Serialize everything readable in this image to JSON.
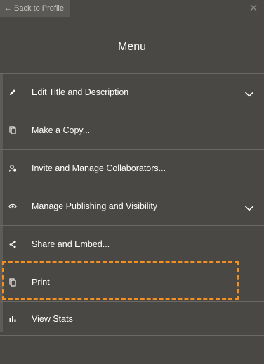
{
  "header": {
    "back_label": "← Back to Profile",
    "title": "Menu"
  },
  "menu": {
    "items": [
      {
        "label": "Edit Title and Description",
        "icon": "pencil-icon",
        "has_chevron": true
      },
      {
        "label": "Make a Copy...",
        "icon": "copy-icon",
        "has_chevron": false
      },
      {
        "label": "Invite and Manage Collaborators...",
        "icon": "collaborators-icon",
        "has_chevron": false
      },
      {
        "label": "Manage Publishing and Visibility",
        "icon": "eye-icon",
        "has_chevron": true
      },
      {
        "label": "Share and Embed...",
        "icon": "share-icon",
        "has_chevron": false
      },
      {
        "label": "Print",
        "icon": "print-icon",
        "has_chevron": false
      },
      {
        "label": "View Stats",
        "icon": "stats-icon",
        "has_chevron": false
      }
    ]
  },
  "colors": {
    "background": "#4a4845",
    "highlight": "#f5901e",
    "divider": "#6a6864"
  }
}
